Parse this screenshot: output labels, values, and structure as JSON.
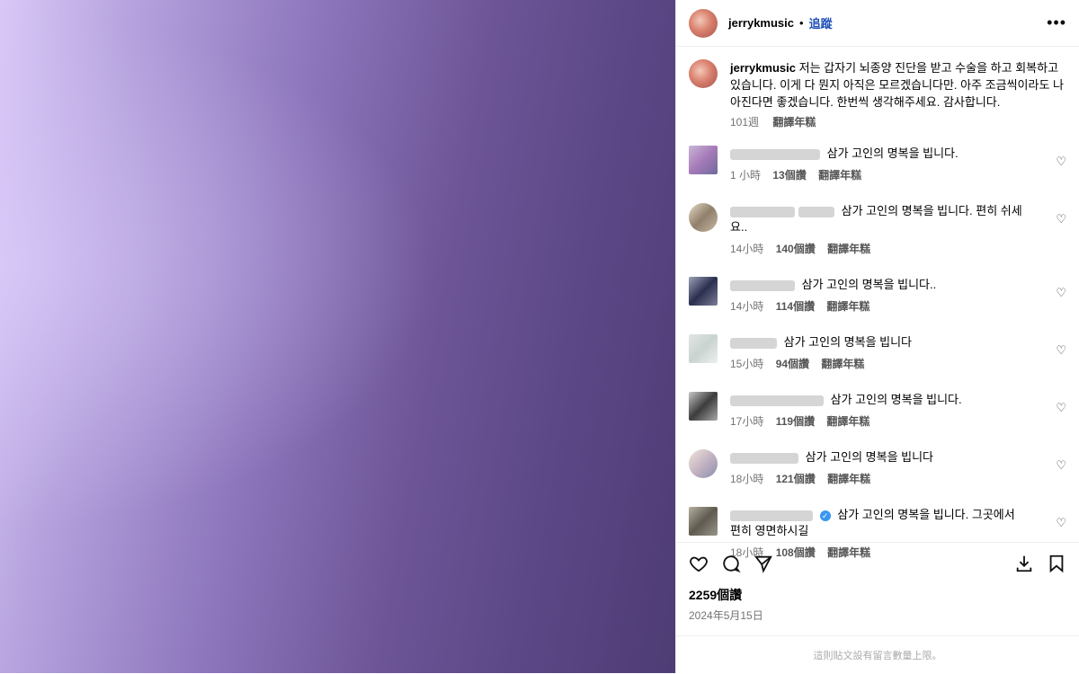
{
  "header": {
    "username": "jerrykmusic",
    "separator": "•",
    "follow_label": "追蹤",
    "more_icon": "more-horizontal-icon"
  },
  "caption": {
    "username": "jerrykmusic",
    "text": "저는 갑자기 뇌종양 진단을 받고 수술을 하고 회복하고 있습니다. 이게 다 뭔지 아직은 모르겠습니다만. 아주 조금씩이라도 나아진다면 좋겠습니다. 한번씩 생각해주세요. 감사합니다.",
    "time": "101週",
    "translate": "翻譯年糕"
  },
  "comments": [
    {
      "text": "삼가 고인의 명복을 빕니다.",
      "time": "1 小時",
      "likes": "13個讚",
      "translate": "翻譯年糕"
    },
    {
      "text": "삼가 고인의 명복을 빕니다. 편히 쉬세요..",
      "time": "14小時",
      "likes": "140個讚",
      "translate": "翻譯年糕"
    },
    {
      "text": "삼가 고인의 명복을 빕니다..",
      "time": "14小時",
      "likes": "114個讚",
      "translate": "翻譯年糕"
    },
    {
      "text": "삼가 고인의 명복을 빕니다",
      "time": "15小時",
      "likes": "94個讚",
      "translate": "翻譯年糕"
    },
    {
      "text": "삼가 고인의 명복을 빕니다.",
      "time": "17小時",
      "likes": "119個讚",
      "translate": "翻譯年糕"
    },
    {
      "text": "삼가 고인의 명복을 빕니다",
      "time": "18小時",
      "likes": "121個讚",
      "translate": "翻譯年糕"
    },
    {
      "text": "삼가 고인의 명복을 빕니다. 그곳에서 편히 영면하시길",
      "time": "18小時",
      "likes": "108個讚",
      "translate": "翻譯年糕"
    }
  ],
  "actions": {
    "like_icon": "heart-icon",
    "comment_icon": "comment-icon",
    "share_icon": "send-icon",
    "download_icon": "download-icon",
    "save_icon": "bookmark-icon"
  },
  "post": {
    "likes": "2259個讚",
    "date": "2024年5月15日"
  },
  "footer": {
    "notice": "這則貼文設有留言數量上限。"
  }
}
